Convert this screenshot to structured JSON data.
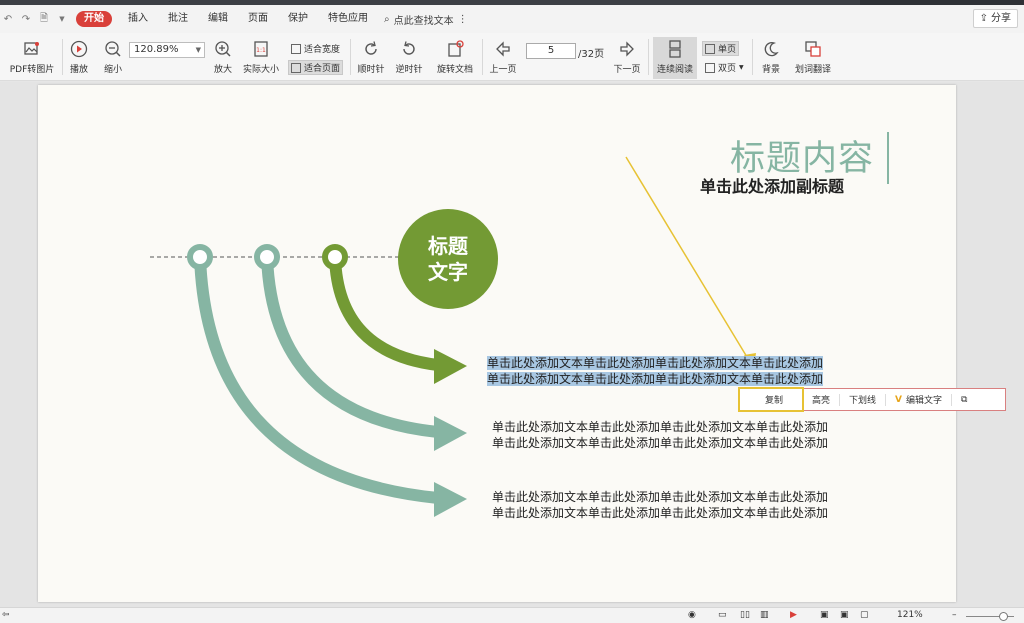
{
  "menu": {
    "items": [
      "开始",
      "插入",
      "批注",
      "编辑",
      "页面",
      "保护",
      "特色应用"
    ],
    "search_text": "点此查找文本",
    "share_label": "分享"
  },
  "toolbar": {
    "pdf_to_image": "PDF转图片",
    "play": "播放",
    "zoom_out": "缩小",
    "zoom_value": "120.89%",
    "zoom_in": "放大",
    "actual_size": "实际大小",
    "fit_width": "适合宽度",
    "fit_page": "适合页面",
    "rotate_cw": "顺时针",
    "rotate_ccw": "逆时针",
    "rotate_doc": "旋转文档",
    "prev_page": "上一页",
    "page_current": "5",
    "page_total": "/32页",
    "next_page": "下一页",
    "continuous": "连续阅读",
    "single_page": "单页",
    "double_page": "双页",
    "background": "背景",
    "translate": "划词翻译"
  },
  "slide": {
    "title": "标题内容",
    "subtitle": "单击此处添加副标题",
    "circle_line1": "标题",
    "circle_line2": "文字",
    "blocks": [
      {
        "line1": "单击此处添加文本单击此处添加单击此处添加文本单击此处添加",
        "line2": "单击此处添加文本单击此处添加单击此处添加文本单击此处添加"
      },
      {
        "line1": "单击此处添加文本单击此处添加单击此处添加文本单击此处添加",
        "line2": "单击此处添加文本单击此处添加单击此处添加文本单击此处添加"
      },
      {
        "line1": "单击此处添加文本单击此处添加单击此处添加文本单击此处添加",
        "line2": "单击此处添加文本单击此处添加单击此处添加文本单击此处添加"
      }
    ]
  },
  "context_menu": {
    "copy": "复制",
    "highlight": "高亮",
    "underline": "下划线",
    "edit_text": "编辑文字"
  },
  "status": {
    "zoom": "121%"
  },
  "colors": {
    "accent_red": "#d9403a",
    "teal": "#86b5a3",
    "green": "#739a34",
    "selection": "#a8c7e2",
    "callout_yellow": "#e7c234"
  }
}
